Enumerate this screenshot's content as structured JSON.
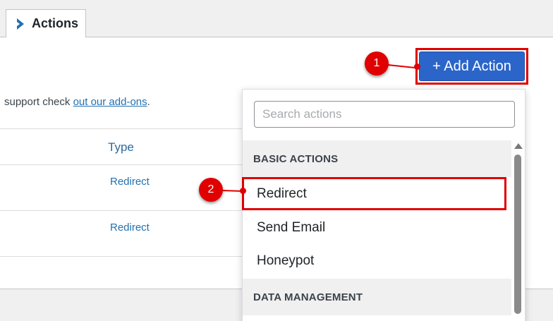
{
  "tab": {
    "label": "Actions",
    "icon": "chevron-right-icon",
    "icon_color": "#2271b1"
  },
  "help": {
    "prefix": "support check ",
    "link": "out our add-ons",
    "suffix": "."
  },
  "table": {
    "column_type": "Type",
    "rows": [
      {
        "type": "Redirect"
      },
      {
        "type": "Redirect"
      }
    ]
  },
  "add_button": {
    "label": "+ Add Action",
    "color": "#2b65c9"
  },
  "annotations": {
    "marker1": "1",
    "marker2": "2",
    "color": "#e00000"
  },
  "dropdown": {
    "search_placeholder": "Search actions",
    "groups": [
      {
        "header": "BASIC ACTIONS",
        "items": [
          "Redirect",
          "Send Email",
          "Honeypot"
        ]
      },
      {
        "header": "DATA MANAGEMENT",
        "items": []
      }
    ]
  }
}
